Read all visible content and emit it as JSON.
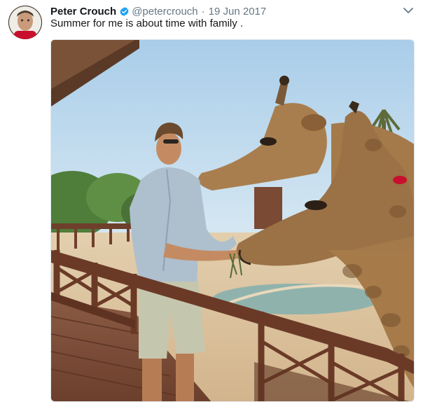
{
  "tweet": {
    "display_name": "Peter Crouch",
    "handle": "@petercrouch",
    "separator": "·",
    "date": "19 Jun 2017",
    "text": "Summer for me is about time with family ."
  },
  "icons": {
    "verified": "verified-badge-icon",
    "caret": "chevron-down-icon"
  },
  "colors": {
    "name": "#14171a",
    "meta": "#657786",
    "verified": "#1da1f2"
  }
}
